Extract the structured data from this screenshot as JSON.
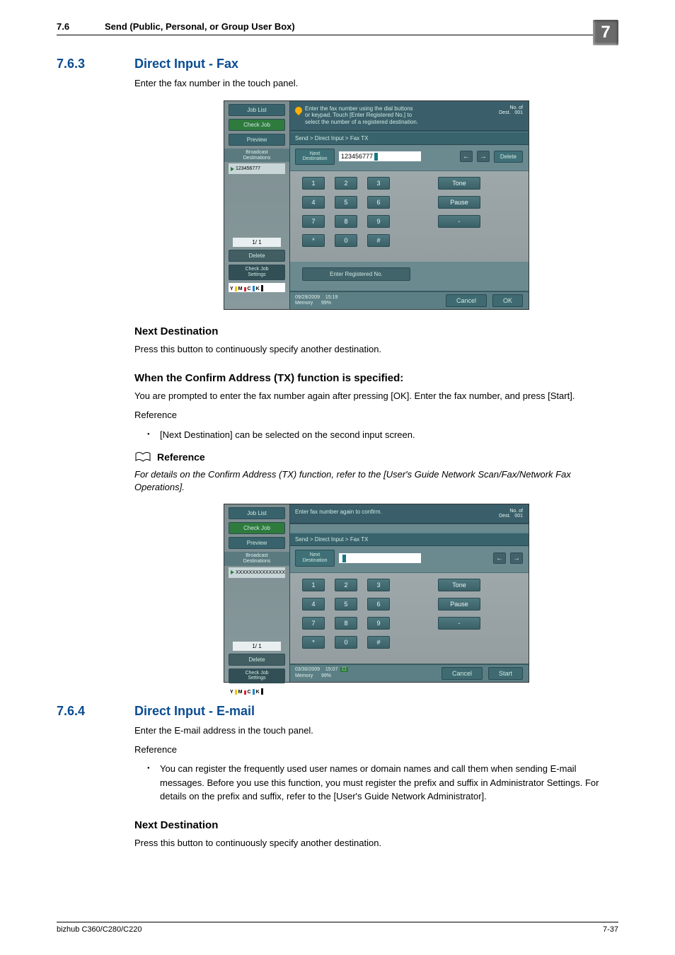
{
  "breadcrumb": {
    "num": "7.6",
    "title": "Send (Public, Personal, or Group User Box)"
  },
  "chapter_badge": "7",
  "s763": {
    "num": "7.6.3",
    "title": "Direct Input - Fax",
    "intro": "Enter the fax number in the touch panel.",
    "nextdest_h": "Next Destination",
    "nextdest_p": "Press this button to continuously specify another destination.",
    "confirm_h": "When the Confirm Address (TX) function is specified:",
    "confirm_p": "You are prompted to enter the fax number again after pressing [OK]. Enter the fax number, and press [Start].",
    "reference_label": "Reference",
    "bullet1": "[Next Destination] can be selected on the second input screen.",
    "ref_icon_label": "Reference",
    "ref_body": "For details on the Confirm Address (TX) function, refer to the [User's Guide Network Scan/Fax/Network Fax Operations]."
  },
  "s764": {
    "num": "7.6.4",
    "title": "Direct Input - E-mail",
    "intro": "Enter the E-mail address in the touch panel.",
    "reference_label": "Reference",
    "bullet1": "You can register the frequently used user names or domain names and call them when sending E-mail messages. Before you use this function, you must register the prefix and suffix in Administrator Settings. For details on the prefix and suffix, refer to the [User's Guide Network Administrator].",
    "nextdest_h": "Next Destination",
    "nextdest_p": "Press this button to continuously specify another destination."
  },
  "shot1": {
    "hint_lines": "Enter the fax number using the dial buttons\nor keypad. Touch [Enter Registered No.] to\nselect the number of a registered destination.",
    "no_of_dest_label": "No. of\nDest.",
    "no_of_dest_value": "001",
    "breadcrumb": "Send > Direct Input > Fax TX",
    "left": {
      "job_list": "Job List",
      "check_job": "Check Job",
      "preview": "Preview",
      "broadcast": "Broadcast\nDestinations",
      "entry_value": "123456777",
      "page": "1/  1",
      "delete": "Delete",
      "check_settings": "Check Job\nSettings"
    },
    "next_dest": "Next\nDestination",
    "fax_value": "123456777",
    "delete_btn": "Delete",
    "keys": {
      "tone": "Tone",
      "pause": "Pause",
      "dash": "-"
    },
    "reg_no": "Enter Registered No.",
    "date": "09/29/2009",
    "time": "15:19",
    "mem_label": "Memory",
    "mem_value": "99%",
    "cancel": "Cancel",
    "ok": "OK"
  },
  "shot2": {
    "hint_line": "Enter fax number again to confirm.",
    "no_of_dest_label": "No. of\nDest.",
    "no_of_dest_value": "001",
    "breadcrumb": "Send > Direct Input > Fax TX",
    "left": {
      "job_list": "Job List",
      "check_job": "Check Job",
      "preview": "Preview",
      "broadcast": "Broadcast\nDestinations",
      "entry_value": "XXXXXXXXXXXXXXX",
      "page": "1/  1",
      "delete": "Delete",
      "check_settings": "Check Job\nSettings"
    },
    "next_dest": "Next\nDestination",
    "keys": {
      "tone": "Tone",
      "pause": "Pause",
      "dash": "-"
    },
    "date": "03/30/2009",
    "time": "15:07",
    "mem_label": "Memory",
    "mem_value": "99%",
    "cancel": "Cancel",
    "start": "Start"
  },
  "footer": {
    "left": "bizhub C360/C280/C220",
    "right": "7-37"
  }
}
